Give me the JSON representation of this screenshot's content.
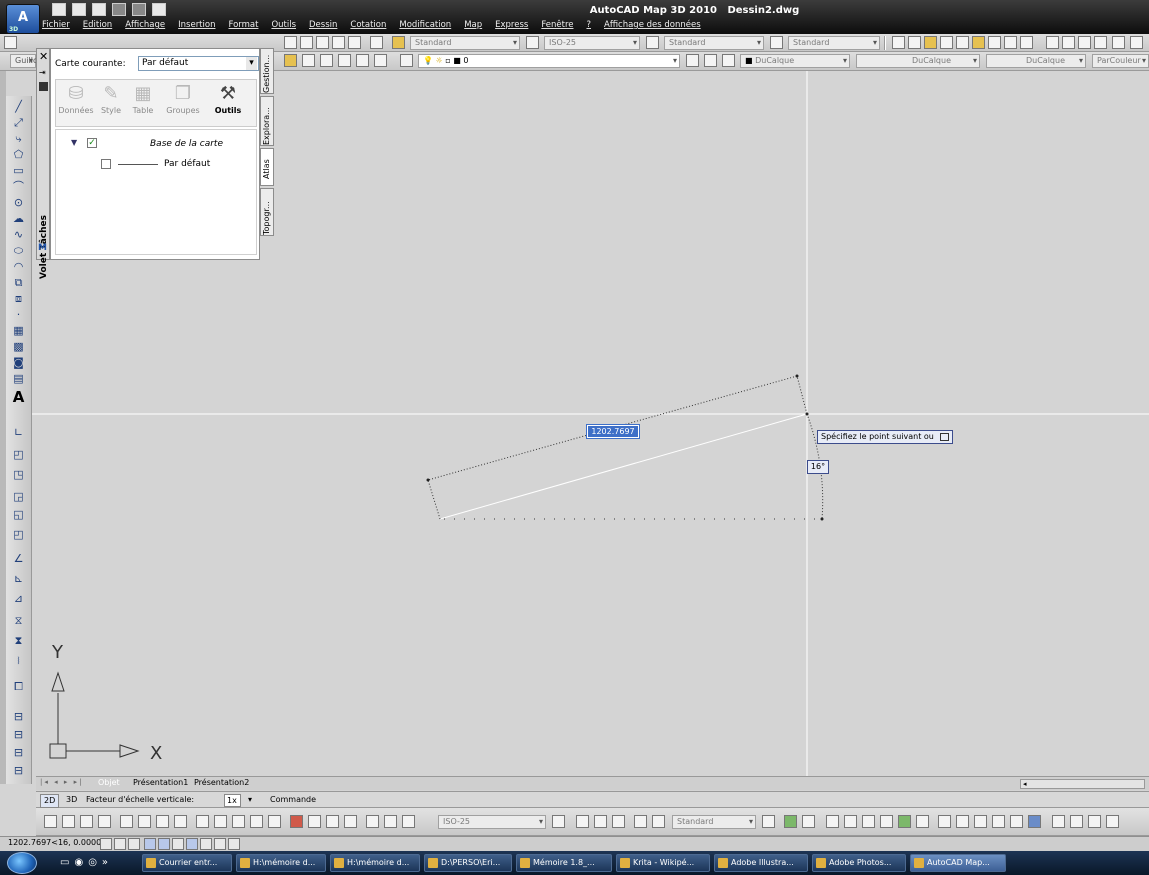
{
  "app": {
    "title": "AutoCAD Map 3D 2010",
    "document": "Dessin2.dwg",
    "logo_label": "3D"
  },
  "menu": [
    "Fichier",
    "Edition",
    "Affichage",
    "Insertion",
    "Format",
    "Outils",
    "Dessin",
    "Cotation",
    "Modification",
    "Map",
    "Express",
    "Fenêtre",
    "?",
    "Affichage des données"
  ],
  "toolbar1": {
    "text_style": "Standard",
    "dim_style": "ISO-25",
    "table_style": "Standard",
    "multileader_style": "Standard"
  },
  "toolbar2": {
    "left_label": "Guillo",
    "layer": "0",
    "color": "DuCalque",
    "linetype": "DuCalque",
    "lineweight": "DuCalque",
    "plot_style": "ParCouleur"
  },
  "taskpane": {
    "title": "Volet Tâches",
    "current_map_label": "Carte courante:",
    "current_map": "Par défaut",
    "tabs": [
      "Gestion...",
      "Explora...",
      "Atlas",
      "Topogr..."
    ],
    "tools": [
      {
        "label": "Données",
        "icon": "database-icon"
      },
      {
        "label": "Style",
        "icon": "brush-icon"
      },
      {
        "label": "Table",
        "icon": "table-icon"
      },
      {
        "label": "Groupes",
        "icon": "groups-icon"
      },
      {
        "label": "Outils",
        "icon": "tools-icon"
      }
    ],
    "tree": {
      "base_label": "Base de la carte",
      "default_label": "Par défaut"
    }
  },
  "canvas": {
    "dimension_value": "1202.7697",
    "prompt": "Spécifiez le point suivant ou",
    "angle": "16°",
    "ucs_x": "X",
    "ucs_y": "Y"
  },
  "layout_tabs": {
    "model": "Objet",
    "tabs": [
      "Présentation1",
      "Présentation2"
    ]
  },
  "command_bar": {
    "btn_2d": "2D",
    "btn_3d": "3D",
    "scale_label": "Facteur d'échelle verticale:",
    "scale_value": "1x",
    "command_label": "Commande"
  },
  "bottom_toolbar": {
    "dim_style": "ISO-25",
    "mleader_style": "Standard"
  },
  "status": {
    "coords": "1202.7697<16, 0.0000"
  },
  "taskbar": {
    "items": [
      "Courrier entr...",
      "H:\\mémoire d...",
      "H:\\mémoire d...",
      "D:\\PERSO\\Eri...",
      "Mémoire 1.8_...",
      "Krita - Wikipé...",
      "Adobe Illustra...",
      "Adobe Photos...",
      "AutoCAD Map..."
    ],
    "active_index": 8
  },
  "colors": {
    "canvas_bg": "#d4d4d4",
    "selection_blue": "#3e6fc7",
    "title_bar": "#1a1a1a"
  }
}
